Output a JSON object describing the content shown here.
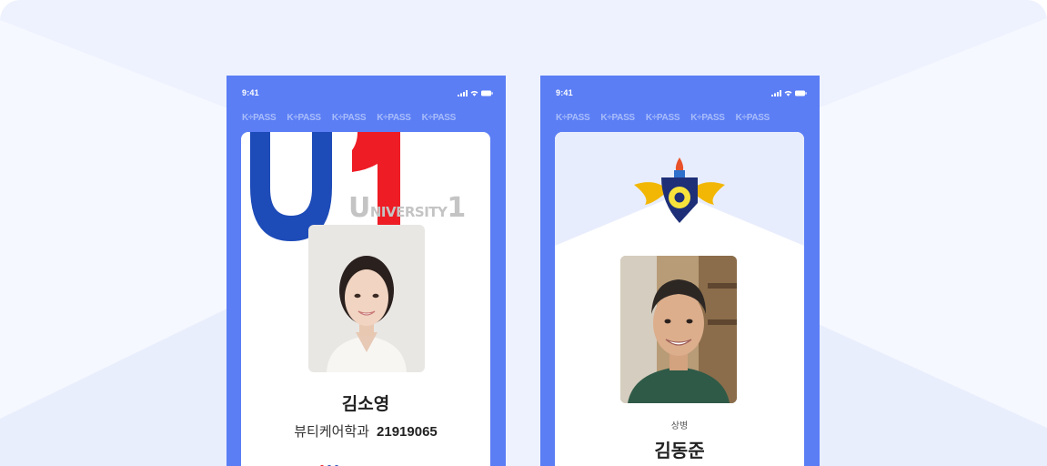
{
  "brand": {
    "colors": {
      "phone_bg": "#5b7ef5",
      "u1_blue": "#1d4bb8",
      "u1_red": "#ee1c25",
      "stage_bg": "#eef2fe"
    }
  },
  "phones": [
    {
      "status": {
        "time": "9:41"
      },
      "watermark": [
        "K÷PASS",
        "K÷PASS",
        "K÷PASS",
        "K÷PASS",
        "K÷PASS"
      ],
      "card": {
        "logo_text": {
          "initial": "U",
          "rest": "NIVERSITY",
          "number": "1"
        },
        "name": "김소영",
        "department": "뷰티케어학과",
        "student_id": "21919065"
      }
    },
    {
      "status": {
        "time": "9:41"
      },
      "watermark": [
        "K÷PASS",
        "K÷PASS",
        "K÷PASS",
        "K÷PASS",
        "K÷PASS"
      ],
      "card": {
        "rank": "상병",
        "name": "김동준"
      }
    }
  ]
}
